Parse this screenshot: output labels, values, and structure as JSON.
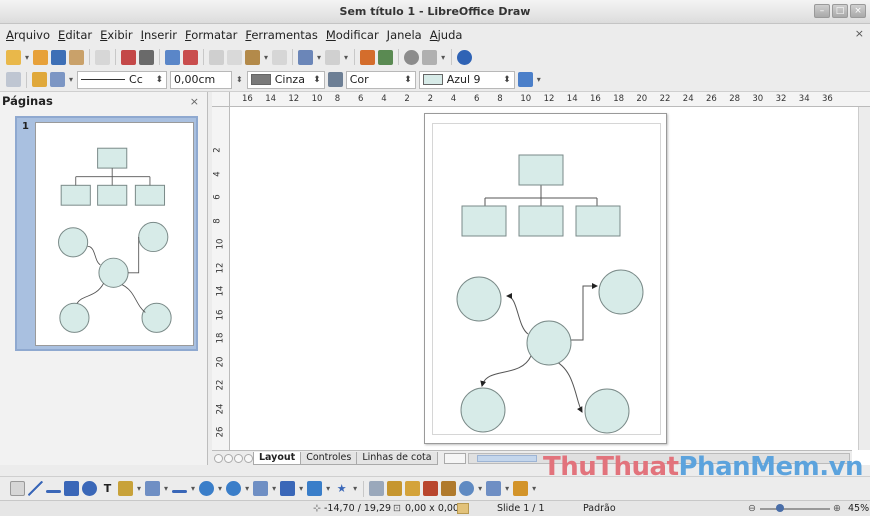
{
  "window": {
    "title": "Sem título 1 - LibreOffice Draw"
  },
  "menu": [
    "Arquivo",
    "Editar",
    "Exibir",
    "Inserir",
    "Formatar",
    "Ferramentas",
    "Modificar",
    "Janela",
    "Ajuda"
  ],
  "line_toolbar": {
    "line_style": "Cc",
    "line_width": "0,00cm",
    "line_color_name": "Cinza",
    "line_color": "#7a7a7a",
    "area_type": "Cor",
    "area_color_name": "Azul 9",
    "area_color": "#d7ebe8"
  },
  "pages_panel": {
    "title": "Páginas",
    "close_glyph": "×",
    "slide_number": "1"
  },
  "ruler": {
    "horizontal": [
      "16",
      "14",
      "12",
      "10",
      "8",
      "6",
      "4",
      "2",
      "2",
      "4",
      "6",
      "8",
      "10",
      "12",
      "14",
      "16",
      "18",
      "20",
      "22",
      "24",
      "26",
      "28",
      "30",
      "32",
      "34",
      "36"
    ],
    "vertical": [
      "2",
      "4",
      "6",
      "8",
      "10",
      "12",
      "14",
      "16",
      "18",
      "20",
      "22",
      "24",
      "26",
      "28"
    ]
  },
  "tabs": [
    "Layout",
    "Controles",
    "Linhas de cota"
  ],
  "status": {
    "position": "-14,70 / 19,29",
    "size": "0,00 x 0,00",
    "slide": "Slide 1 / 1",
    "layout": "Padrão",
    "zoom": "45%"
  },
  "watermark": {
    "part1": "Thu",
    "part2": "Thuat",
    "part3": "PhanMem",
    "part4": ".vn"
  },
  "colors": {
    "shape_fill": "#d7ebe8",
    "shape_stroke": "#7a8a88",
    "accent": "#4a6ea8"
  }
}
